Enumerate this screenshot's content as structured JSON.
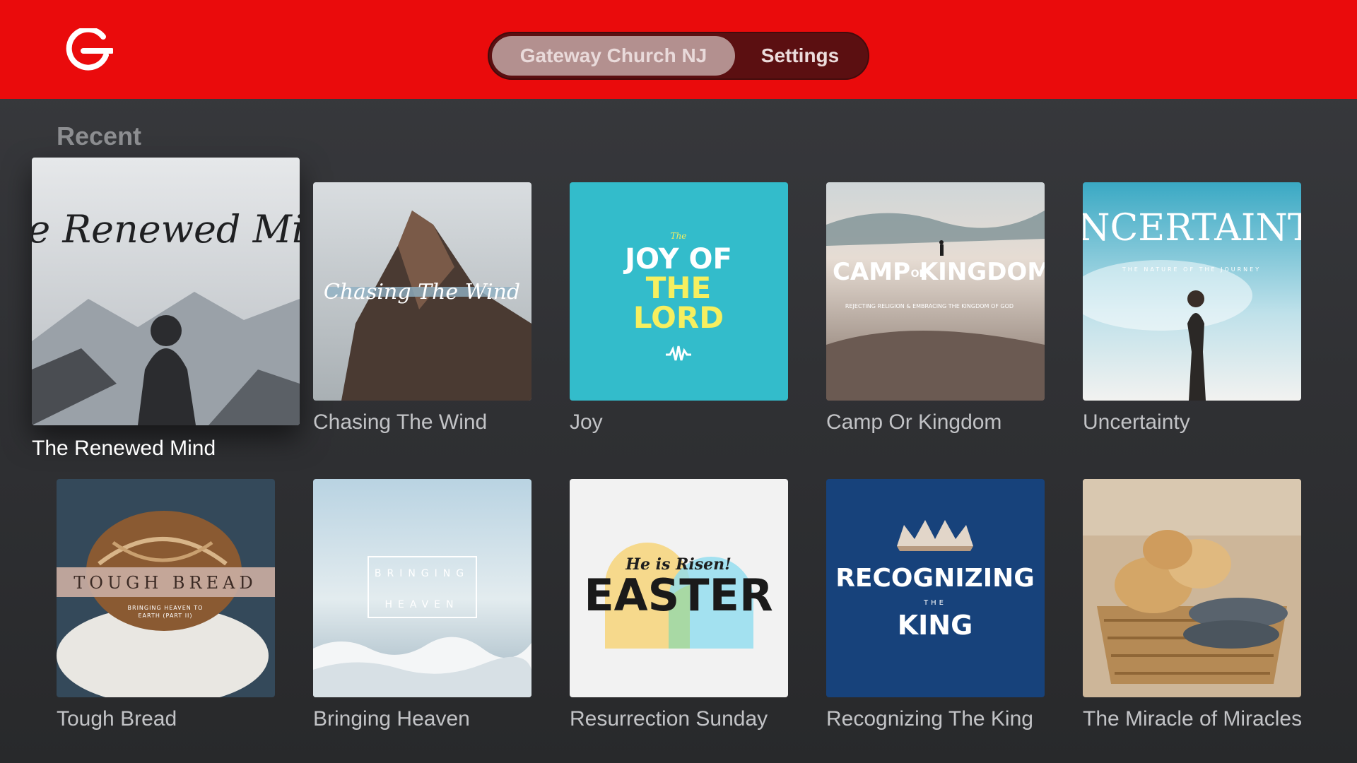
{
  "nav": {
    "tabs": [
      {
        "label": "Gateway Church NJ",
        "active": true
      },
      {
        "label": "Settings",
        "active": false
      }
    ]
  },
  "recent": {
    "title": "Recent",
    "items": [
      {
        "title": "The Renewed Mind",
        "art_text": "The Renewed Mind"
      },
      {
        "title": "Chasing The Wind",
        "art_text": "Chasing The Wind"
      },
      {
        "title": "Joy",
        "art_small": "The",
        "art_line1": "JOY OF",
        "art_line2": "THE",
        "art_line3": "LORD"
      },
      {
        "title": "Camp Or Kingdom",
        "art_line1": "CAMP",
        "art_or": "OR",
        "art_line2": "KINGDOM",
        "art_sub": "REJECTING RELIGION & EMBRACING THE KINGDOM OF GOD"
      },
      {
        "title": "Uncertainty",
        "art_text": "UNCERTAINTY",
        "art_sub": "THE NATURE OF THE JOURNEY"
      },
      {
        "title": "Tough Bread",
        "art_text": "TOUGH BREAD",
        "art_sub1": "BRINGING HEAVEN TO",
        "art_sub2": "EARTH (PART II)"
      },
      {
        "title": "Bringing Heaven",
        "art_line1": "BRINGING",
        "art_line2": "HEAVEN"
      },
      {
        "title": "Resurrection Sunday",
        "art_small": "He is Risen!",
        "art_text": "EASTER"
      },
      {
        "title": "Recognizing The King",
        "art_line1": "RECOGNIZING",
        "art_the": "THE",
        "art_line2": "KING"
      },
      {
        "title": "The Miracle of Miracles"
      }
    ]
  },
  "colors": {
    "brand_red": "#ea0b0c",
    "nav_pill": "#5b0f11",
    "active_tab": "#b3908f"
  }
}
